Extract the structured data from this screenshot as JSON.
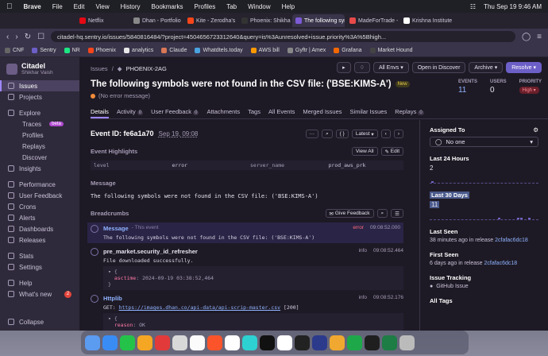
{
  "menubar": {
    "apple": "",
    "app": "Brave",
    "items": [
      "File",
      "Edit",
      "View",
      "History",
      "Bookmarks",
      "Profiles",
      "Tab",
      "Window",
      "Help"
    ],
    "clock": "Thu Sep 19  9:46 AM"
  },
  "browser": {
    "tabs": [
      {
        "label": "Netflix",
        "color": "#e50914"
      },
      {
        "label": "Dhan - Portfolio",
        "color": "#888888"
      },
      {
        "label": "Kite - Zerodha's fast an",
        "color": "#f6461a"
      },
      {
        "label": "Phoenix: Shikhar",
        "color": "#333333"
      },
      {
        "label": "The following symbo",
        "color": "#7d5bd6",
        "active": true
      },
      {
        "label": "MadeForTrade - Join the",
        "color": "#e84a4a"
      },
      {
        "label": "Krishna Institute Of Med",
        "color": "#ffffff"
      }
    ],
    "url": "citadel-hq.sentry.io/issues/5840816484/?project=4504656723312640&query=is%3Aunresolved+issue.priority%3A%5Bhigh...",
    "bookmarks": [
      "CNF",
      "Sentry",
      "NR",
      "Phoenix",
      "analytics",
      "Claude",
      "Whatdtels.today",
      "AWS bill",
      "Gyftr | Amex",
      "Grafana",
      "Market Hound"
    ]
  },
  "sidebar": {
    "org": "Citadel",
    "user": "Shikhar Vaish",
    "items": [
      {
        "label": "Issues",
        "active": true
      },
      {
        "label": "Projects"
      },
      {
        "label": "Explore"
      },
      {
        "label": "Traces",
        "sub": true,
        "badge": "beta"
      },
      {
        "label": "Profiles",
        "sub": true
      },
      {
        "label": "Replays",
        "sub": true
      },
      {
        "label": "Discover",
        "sub": true
      },
      {
        "label": "Insights"
      },
      {
        "label": "Performance"
      },
      {
        "label": "User Feedback"
      },
      {
        "label": "Crons"
      },
      {
        "label": "Alerts"
      },
      {
        "label": "Dashboards"
      },
      {
        "label": "Releases"
      },
      {
        "label": "Stats"
      },
      {
        "label": "Settings"
      },
      {
        "label": "Help"
      },
      {
        "label": "What's new",
        "count": "2"
      }
    ],
    "collapse": "Collapse"
  },
  "issue": {
    "breadcrumb": [
      "Issues",
      "PHOENIX-2AG"
    ],
    "title": "The following symbols were not found in the CSV file: ('BSE:KIMS-A')",
    "new_badge": "New",
    "subtitle": "(No error message)",
    "buttons": {
      "envs": "All Envs",
      "discover": "Open in Discover",
      "archive": "Archive",
      "resolve": "Resolve"
    },
    "stats": {
      "events_label": "EVENTS",
      "events": "11",
      "users_label": "USERS",
      "users": "0",
      "priority_label": "PRIORITY",
      "priority": "High"
    },
    "tabs": [
      {
        "label": "Details",
        "active": true
      },
      {
        "label": "Activity",
        "count": "0"
      },
      {
        "label": "User Feedback",
        "count": "0"
      },
      {
        "label": "Attachments"
      },
      {
        "label": "Tags"
      },
      {
        "label": "All Events"
      },
      {
        "label": "Merged Issues"
      },
      {
        "label": "Similar Issues"
      },
      {
        "label": "Replays",
        "count": "0"
      }
    ]
  },
  "event": {
    "id_label": "Event ID: fe6a1a70",
    "date": "Sep 19, 09:08",
    "latest": "Latest",
    "highlights_title": "Event Highlights",
    "view_all": "View All",
    "edit": "Edit",
    "highlights": [
      [
        "level",
        "error",
        "server_name",
        "prod_aws_prk"
      ]
    ],
    "message_title": "Message",
    "message": "The following symbols were not found in the CSV file: ('BSE:KIMS-A')",
    "breadcrumbs_title": "Breadcrumbs",
    "give_feedback": "Give Feedback",
    "breadcrumbs": [
      {
        "title": "Message",
        "tag": "- This event",
        "level": "error",
        "time": "09:08:52.000",
        "text": "The following symbols were not found in the CSV file: ('BSE:KIMS-A')",
        "kind": "msg"
      },
      {
        "title": "pre_market.security_id_refresher",
        "level": "info",
        "time": "09:08:52.464",
        "text": "File downloaded successfully.",
        "obj_key": "asctime",
        "obj_val": "2024-09-19 03:38:52,464"
      },
      {
        "title": "Httplib",
        "level": "info",
        "time": "09:08:52.176",
        "text_prefix": "GET: ",
        "link": "https://images.dhan.co/api-data/api-scrip-master.csv",
        "text_suffix": " [200]",
        "obj_key": "reason",
        "obj_val": "OK"
      }
    ]
  },
  "right": {
    "assigned_to": "Assigned To",
    "no_one": "No one",
    "last24": "Last 24 Hours",
    "last24_val": "2",
    "last30": "Last 30 Days",
    "last30_val": "11",
    "last_seen": "Last Seen",
    "last_seen_val": "38 minutes ago in release ",
    "last_seen_rel": "2cfafac6dc18",
    "first_seen": "First Seen",
    "first_seen_val": "6 days ago in release ",
    "first_seen_rel": "2cfafac6dc18",
    "tracking": "Issue Tracking",
    "github": "GitHub Issue",
    "all_tags": "All Tags"
  },
  "dock_colors": [
    "#5b9bf0",
    "#3a8cf5",
    "#25c24a",
    "#f5a623",
    "#e23a3a",
    "#d8d8d8",
    "#fbfbfb",
    "#fb542b",
    "#ffffff",
    "#2ed1d1",
    "#111111",
    "#ffffff",
    "#222222",
    "#2c3a8c",
    "#f0a830",
    "#1ea84a",
    "#1f1f1f",
    "#1e7c45",
    "#bbbbbb"
  ]
}
